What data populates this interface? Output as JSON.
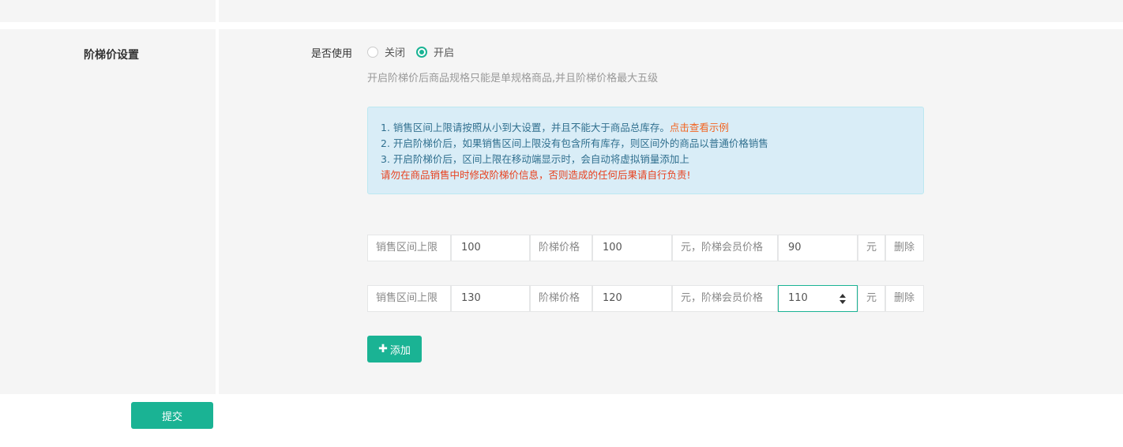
{
  "section": {
    "title": "阶梯价设置",
    "enable_label": "是否使用",
    "radios": [
      {
        "label": "关闭",
        "checked": false
      },
      {
        "label": "开启",
        "checked": true
      }
    ],
    "help_text": "开启阶梯价后商品规格只能是单规格商品,并且阶梯价格最大五级",
    "info": {
      "line1": "1. 销售区间上限请按照从小到大设置，并且不能大于商品总库存。",
      "line1_link": "点击查看示例",
      "line2": "2. 开启阶梯价后，如果销售区间上限没有包含所有库存，则区间外的商品以普通价格销售",
      "line3": "3. 开启阶梯价后，区间上限在移动端显示时，会自动将虚拟销量添加上",
      "warning": "请勿在商品销售中时修改阶梯价信息，否则造成的任何后果请自行负责!"
    },
    "tiers": [
      {
        "range_label": "销售区间上限",
        "range_value": "100",
        "price_label": "阶梯价格",
        "price_value": "100",
        "member_label": "元，阶梯会员价格",
        "member_value": "90",
        "unit": "元",
        "delete_label": "删除"
      },
      {
        "range_label": "销售区间上限",
        "range_value": "130",
        "price_label": "阶梯价格",
        "price_value": "120",
        "member_label": "元，阶梯会员价格",
        "member_value": "110",
        "unit": "元",
        "delete_label": "删除"
      }
    ],
    "add_button": "添加"
  },
  "submit_button": "提交",
  "colors": {
    "accent": "#1ab394",
    "link": "#f26522",
    "warning": "#e8411f"
  }
}
